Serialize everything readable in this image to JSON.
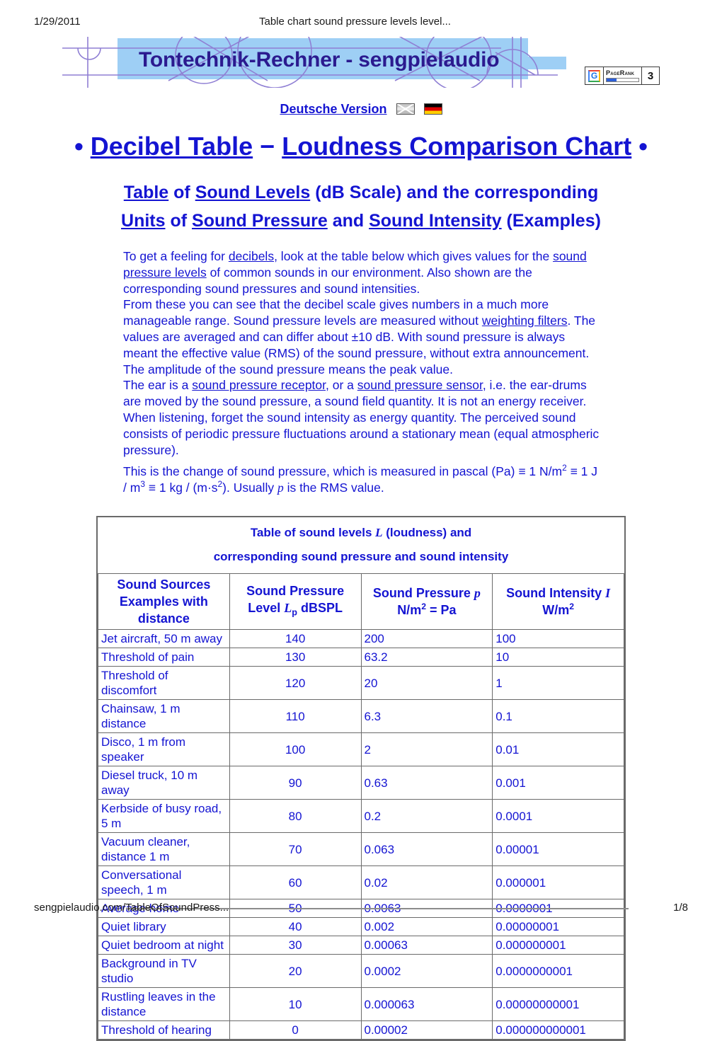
{
  "print_header": {
    "date": "1/29/2011",
    "doc_title": "Table chart sound pressure levels level..."
  },
  "banner": {
    "text": "Tontechnik-Rechner - sengpielaudio",
    "bg_color": "#9ecff5",
    "text_color": "#2b1a8f",
    "line_art_color": "#8f7fd4"
  },
  "pagerank": {
    "g_letter": "G",
    "label": "PageRank",
    "value": "3",
    "bar_percent": 30
  },
  "language_row": {
    "link_label": "Deutsche Version",
    "flag_1": "uk-flag-icon",
    "flag_2": "german-flag-icon"
  },
  "title": {
    "bullet_left": "•",
    "part_1": "Decibel Table",
    "separator": "−",
    "part_2": "Loudness Comparison Chart",
    "bullet_right": "•",
    "color": "#1414d2"
  },
  "subtitle": {
    "line_1": [
      {
        "t": "Table",
        "link": true
      },
      {
        "t": " of ",
        "link": false
      },
      {
        "t": "Sound Levels",
        "link": true
      },
      {
        "t": " (dB Scale) and the corresponding",
        "link": false
      }
    ],
    "line_2": [
      {
        "t": "Units",
        "link": true
      },
      {
        "t": " of ",
        "link": false
      },
      {
        "t": "Sound Pressure",
        "link": true
      },
      {
        "t": " and ",
        "link": false
      },
      {
        "t": "Sound Intensity",
        "link": true
      },
      {
        "t": " (Examples)",
        "link": false
      }
    ]
  },
  "body": {
    "para_1": "To get a feeling for decibels, look at the table below which gives values for the sound pressure levels of common sounds in our environment. Also shown are the corresponding sound pressures and sound intensities.",
    "para_2": "From these you can see that the decibel scale gives numbers in a much more manageable range. Sound pressure levels are measured without weighting filters. The values are averaged and can differ about ±10 dB. With sound pressure is always meant the effective value (RMS) of the sound pressure, without extra announcement. The amplitude of the sound pressure means the peak value.",
    "para_3": "The ear is a sound pressure receptor, or a sound pressure sensor, i.e. the ear-drums are moved by the sound pressure, a sound field quantity. It is not an energy receiver. When listening, forget the sound intensity as energy quantity. The perceived sound consists of periodic pressure fluctuations around a stationary mean (equal atmospheric pressure).",
    "para_4": "This is the change of sound pressure, which is measured in pascal (Pa) ≡ 1 N/m2 ≡ 1 J / m3 ≡ 1 kg / (m·s2). Usually p is the RMS value.",
    "links": [
      "decibels",
      "sound pressure levels",
      "weighting filters",
      "sound pressure receptor",
      "sound pressure sensor"
    ]
  },
  "table": {
    "caption_line_1": "Table of sound levels L (loudness) and",
    "caption_line_2": "corresponding sound pressure and sound intensity",
    "headers": {
      "sources_line_1": "Sound Sources",
      "sources_line_2": "Examples with distance",
      "level_line_1": "Sound Pressure",
      "level_line_2": "Level Lp dBSPL",
      "pressure_line_1": "Sound Pressure p",
      "pressure_line_2": "N/m2 = Pa",
      "intensity_line_1": "Sound Intensity I",
      "intensity_line_2": "W/m2"
    },
    "rows": [
      {
        "source": "Jet aircraft, 50 m away",
        "level": "140",
        "pressure": "200",
        "intensity": "100"
      },
      {
        "source": "Threshold of pain",
        "level": "130",
        "pressure": "63.2",
        "intensity": "10"
      },
      {
        "source": "Threshold of discomfort",
        "level": "120",
        "pressure": "20",
        "intensity": "1"
      },
      {
        "source": "Chainsaw, 1 m distance",
        "level": "110",
        "pressure": "6.3",
        "intensity": "0.1"
      },
      {
        "source": "Disco, 1 m from speaker",
        "level": "100",
        "pressure": "2",
        "intensity": "0.01"
      },
      {
        "source": "Diesel truck, 10 m away",
        "level": "90",
        "pressure": "0.63",
        "intensity": "0.001"
      },
      {
        "source": "Kerbside of busy road, 5 m",
        "level": "80",
        "pressure": "0.2",
        "intensity": "0.0001"
      },
      {
        "source": "Vacuum cleaner, distance 1 m",
        "level": "70",
        "pressure": "0.063",
        "intensity": "0.00001"
      },
      {
        "source": "Conversational speech, 1 m",
        "level": "60",
        "pressure": "0.02",
        "intensity": "0.000001"
      },
      {
        "source": "Average home",
        "level": "50",
        "pressure": "0.0063",
        "intensity": "0.0000001"
      },
      {
        "source": "Quiet library",
        "level": "40",
        "pressure": "0.002",
        "intensity": "0.00000001"
      },
      {
        "source": "Quiet bedroom at night",
        "level": "30",
        "pressure": "0.00063",
        "intensity": "0.000000001"
      },
      {
        "source": "Background in TV studio",
        "level": "20",
        "pressure": "0.0002",
        "intensity": "0.0000000001"
      },
      {
        "source": "Rustling leaves in the distance",
        "level": "10",
        "pressure": "0.000063",
        "intensity": "0.00000000001"
      },
      {
        "source": "Threshold of hearing",
        "level": "0",
        "pressure": "0.00002",
        "intensity": "0.000000000001"
      }
    ]
  },
  "chart_data": {
    "type": "table",
    "title": "Table of sound levels L (loudness) and corresponding sound pressure and sound intensity",
    "columns": [
      "Sound Sources Examples with distance",
      "Sound Pressure Level Lp dBSPL",
      "Sound Pressure p N/m2 = Pa",
      "Sound Intensity I W/m2"
    ],
    "categories": [
      "Jet aircraft, 50 m away",
      "Threshold of pain",
      "Threshold of discomfort",
      "Chainsaw, 1 m distance",
      "Disco, 1 m from speaker",
      "Diesel truck, 10 m away",
      "Kerbside of busy road, 5 m",
      "Vacuum cleaner, distance 1 m",
      "Conversational speech, 1 m",
      "Average home",
      "Quiet library",
      "Quiet bedroom at night",
      "Background in TV studio",
      "Rustling leaves in the distance",
      "Threshold of hearing"
    ],
    "series": [
      {
        "name": "Sound Pressure Level Lp (dBSPL)",
        "values": [
          140,
          130,
          120,
          110,
          100,
          90,
          80,
          70,
          60,
          50,
          40,
          30,
          20,
          10,
          0
        ]
      },
      {
        "name": "Sound Pressure p (N/m2 = Pa)",
        "values": [
          200,
          63.2,
          20,
          6.3,
          2,
          0.63,
          0.2,
          0.063,
          0.02,
          0.0063,
          0.002,
          0.00063,
          0.0002,
          6.3e-05,
          2e-05
        ]
      },
      {
        "name": "Sound Intensity I (W/m2)",
        "values": [
          100,
          10,
          1,
          0.1,
          0.01,
          0.001,
          0.0001,
          1e-05,
          1e-06,
          1e-07,
          1e-08,
          1e-09,
          1e-10,
          1e-11,
          1e-12
        ]
      }
    ]
  },
  "print_footer": {
    "url": "sengpielaudio.com/TableOfSoundPress...",
    "page": "1/8"
  }
}
